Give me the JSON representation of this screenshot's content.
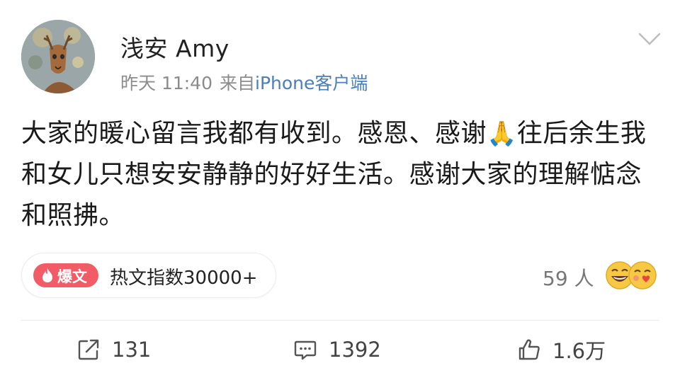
{
  "post": {
    "username": "浅安 Amy",
    "time": "昨天 11:40",
    "source_prefix": "来自",
    "source": "iPhone客户端",
    "text_before_emoji": "大家的暖心留言我都有收到。感恩、感谢",
    "emoji": "🙏",
    "text_after_emoji": "往后余生我和女儿只想安安静静的好好生活。感谢大家的理解惦念和照拂。"
  },
  "hot": {
    "badge": "爆文",
    "text": "热文指数30000+"
  },
  "reactions": {
    "count": "59 人",
    "icons": [
      "laughing-emoji-icon",
      "kiss-emoji-icon"
    ]
  },
  "actions": {
    "repost_count": "131",
    "comment_count": "1392",
    "like_count": "1.6万"
  },
  "colors": {
    "badge": "#f25c67",
    "source_link": "#4a7fb7",
    "meta": "#8c8c8c"
  }
}
